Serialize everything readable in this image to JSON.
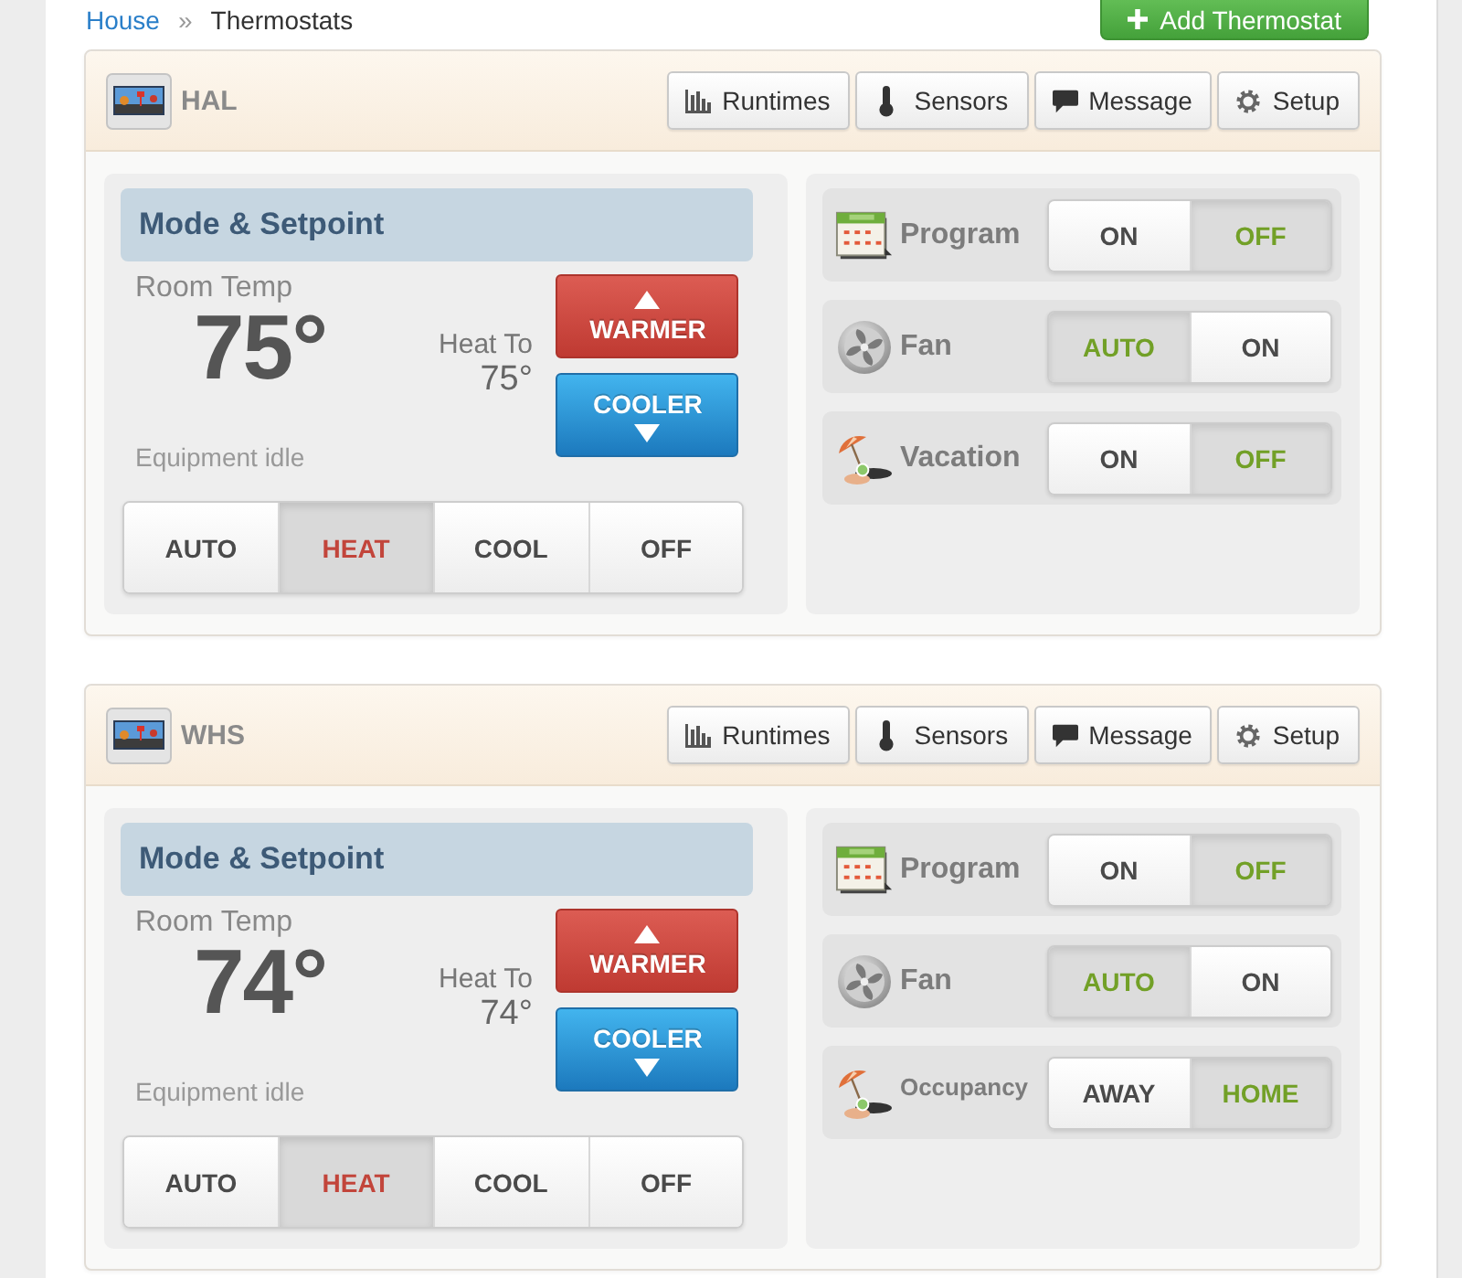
{
  "breadcrumb": [
    {
      "label": "House",
      "kind": "link"
    },
    {
      "label": "Thermostats",
      "kind": "current"
    }
  ],
  "breadcrumb_separator": "»",
  "add_button": {
    "label": "Add Thermostat"
  },
  "thermostats": [
    {
      "name": "HAL",
      "actions": [
        {
          "kind": "runtimes",
          "label": "Runtimes"
        },
        {
          "kind": "sensors",
          "label": "Sensors"
        },
        {
          "kind": "message",
          "label": "Message"
        },
        {
          "kind": "setup",
          "label": "Setup"
        }
      ],
      "mode_panel": {
        "title": "Mode & Setpoint",
        "room_temp_label": "Room Temp",
        "room_temp": "75°",
        "setpoint_label": "Heat To",
        "setpoint": "75°",
        "warmer_label": "WARMER",
        "cooler_label": "COOLER",
        "status": "Equipment idle",
        "modes": [
          {
            "label": "AUTO",
            "selected": false
          },
          {
            "label": "HEAT",
            "selected": true
          },
          {
            "label": "COOL",
            "selected": false
          },
          {
            "label": "OFF",
            "selected": false
          }
        ]
      },
      "settings": [
        {
          "kind": "program",
          "label": "Program",
          "options": [
            {
              "label": "ON",
              "selected": false
            },
            {
              "label": "OFF",
              "selected": true
            }
          ]
        },
        {
          "kind": "fan",
          "label": "Fan",
          "options": [
            {
              "label": "AUTO",
              "selected": true
            },
            {
              "label": "ON",
              "selected": false
            }
          ]
        },
        {
          "kind": "vacation",
          "label": "Vacation",
          "options": [
            {
              "label": "ON",
              "selected": false
            },
            {
              "label": "OFF",
              "selected": true
            }
          ]
        }
      ]
    },
    {
      "name": "WHS",
      "actions": [
        {
          "kind": "runtimes",
          "label": "Runtimes"
        },
        {
          "kind": "sensors",
          "label": "Sensors"
        },
        {
          "kind": "message",
          "label": "Message"
        },
        {
          "kind": "setup",
          "label": "Setup"
        }
      ],
      "mode_panel": {
        "title": "Mode & Setpoint",
        "room_temp_label": "Room Temp",
        "room_temp": "74°",
        "setpoint_label": "Heat To",
        "setpoint": "74°",
        "warmer_label": "WARMER",
        "cooler_label": "COOLER",
        "status": "Equipment idle",
        "modes": [
          {
            "label": "AUTO",
            "selected": false
          },
          {
            "label": "HEAT",
            "selected": true
          },
          {
            "label": "COOL",
            "selected": false
          },
          {
            "label": "OFF",
            "selected": false
          }
        ]
      },
      "settings": [
        {
          "kind": "program",
          "label": "Program",
          "options": [
            {
              "label": "ON",
              "selected": false
            },
            {
              "label": "OFF",
              "selected": true
            }
          ]
        },
        {
          "kind": "fan",
          "label": "Fan",
          "options": [
            {
              "label": "AUTO",
              "selected": true
            },
            {
              "label": "ON",
              "selected": false
            }
          ]
        },
        {
          "kind": "occupancy",
          "label": "Occupancy",
          "options": [
            {
              "label": "AWAY",
              "selected": false
            },
            {
              "label": "HOME",
              "selected": true
            }
          ]
        }
      ]
    }
  ]
}
